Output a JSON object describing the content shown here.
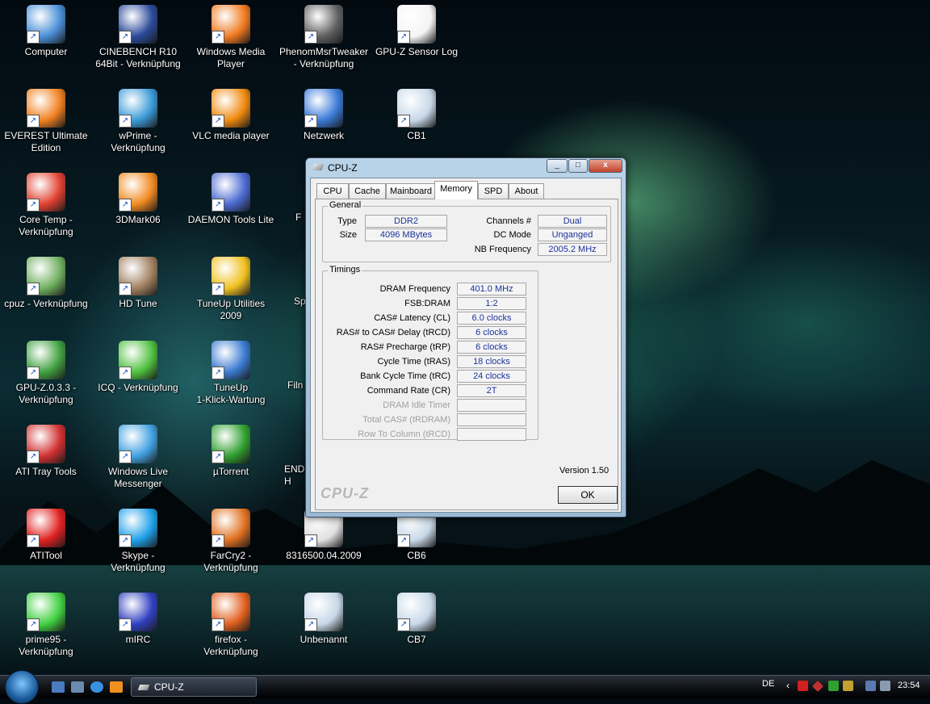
{
  "desktop": {
    "icons": [
      {
        "label": "Computer",
        "icon": "computer-icon",
        "color": "#4a8fd8"
      },
      {
        "label": "CINEBENCH R10\n64Bit - Verknüpfung",
        "icon": "cinebench-icon",
        "color": "#2a4a9a"
      },
      {
        "label": "Windows Media\nPlayer",
        "icon": "media-player-icon",
        "color": "#f07a20"
      },
      {
        "label": "PhenomMsrTweaker\n- Verknüpfung",
        "icon": "chip-icon",
        "color": "#606060"
      },
      {
        "label": "GPU-Z Sensor Log",
        "icon": "text-file-icon",
        "color": "#f4f4f4"
      },
      {
        "label": "EVEREST Ultimate\nEdition",
        "icon": "everest-icon",
        "color": "#f08020"
      },
      {
        "label": "wPrime -\nVerknüpfung",
        "icon": "wprime-icon",
        "color": "#3a9ad8"
      },
      {
        "label": "VLC media player",
        "icon": "vlc-icon",
        "color": "#f08a10"
      },
      {
        "label": "Netzwerk",
        "icon": "network-icon",
        "color": "#3a7ad8"
      },
      {
        "label": "CB1",
        "icon": "screenshot-file-icon",
        "color": "#c8d8e8"
      },
      {
        "label": "Core Temp -\nVerknüpfung",
        "icon": "thermometer-icon",
        "color": "#e04030"
      },
      {
        "label": "3DMark06",
        "icon": "3dmark-icon",
        "color": "#f08a20"
      },
      {
        "label": "DAEMON Tools Lite",
        "icon": "daemon-tools-icon",
        "color": "#4a6ad0"
      },
      {
        "label": "cpuz - Verknüpfung",
        "icon": "cpuz-icon",
        "color": "#70b060"
      },
      {
        "label": "HD Tune",
        "icon": "hd-tune-icon",
        "color": "#a08060"
      },
      {
        "label": "TuneUp Utilities 2009",
        "icon": "tuneup-icon",
        "color": "#f0c020"
      },
      {
        "label": "GPU-Z.0.3.3 -\nVerknüpfung",
        "icon": "graphics-card-icon",
        "color": "#40a040"
      },
      {
        "label": "ICQ - Verknüpfung",
        "icon": "icq-flower-icon",
        "color": "#50c040"
      },
      {
        "label": "TuneUp\n1-Klick-Wartung",
        "icon": "tuneup-wartung-icon",
        "color": "#3a7ad0"
      },
      {
        "label": "ATI Tray Tools",
        "icon": "ati-tray-icon",
        "color": "#d03030"
      },
      {
        "label": "Windows Live\nMessenger",
        "icon": "messenger-icon",
        "color": "#40a0e0"
      },
      {
        "label": "µTorrent",
        "icon": "utorrent-icon",
        "color": "#30a030"
      },
      {
        "label": "ATITool",
        "icon": "atitool-icon",
        "color": "#e02020"
      },
      {
        "label": "Skype - Verknüpfung",
        "icon": "skype-icon",
        "color": "#20a0e8"
      },
      {
        "label": "FarCry2 -\nVerknüpfung",
        "icon": "farcry-icon",
        "color": "#e07020"
      },
      {
        "label": "8316500.04.2009",
        "icon": "pdf-file-icon",
        "color": "#e0e0e0"
      },
      {
        "label": "CB6",
        "icon": "screenshot-file-icon",
        "color": "#c8d8e8"
      },
      {
        "label": "prime95 -\nVerknüpfung",
        "icon": "prime95-icon",
        "color": "#40d040"
      },
      {
        "label": "mIRC",
        "icon": "mirc-icon",
        "color": "#3040c0"
      },
      {
        "label": "firefox -\nVerknüpfung",
        "icon": "firefox-icon",
        "color": "#e06020"
      },
      {
        "label": "Unbenannt",
        "icon": "screenshot-file-icon",
        "color": "#c8d8e8"
      },
      {
        "label": "CB7",
        "icon": "screenshot-file-icon",
        "color": "#c8d8e8"
      }
    ],
    "partial_labels": [
      "F",
      "Sp",
      "Filn",
      "END\nH"
    ]
  },
  "window": {
    "title": "CPU-Z",
    "min": "_",
    "max": "□",
    "close": "x",
    "tabs": [
      "CPU",
      "Cache",
      "Mainboard",
      "Memory",
      "SPD",
      "About"
    ],
    "active_tab": "Memory",
    "general": {
      "label": "General",
      "type_label": "Type",
      "type_value": "DDR2",
      "size_label": "Size",
      "size_value": "4096 MBytes",
      "channels_label": "Channels #",
      "channels_value": "Dual",
      "dcmode_label": "DC Mode",
      "dcmode_value": "Unganged",
      "nbfreq_label": "NB Frequency",
      "nbfreq_value": "2005.2 MHz"
    },
    "timings": {
      "label": "Timings",
      "rows": [
        {
          "label": "DRAM Frequency",
          "value": "401.0 MHz"
        },
        {
          "label": "FSB:DRAM",
          "value": "1:2"
        },
        {
          "label": "CAS# Latency (CL)",
          "value": "6.0 clocks"
        },
        {
          "label": "RAS# to CAS# Delay (tRCD)",
          "value": "6 clocks"
        },
        {
          "label": "RAS# Precharge (tRP)",
          "value": "6 clocks"
        },
        {
          "label": "Cycle Time (tRAS)",
          "value": "18 clocks"
        },
        {
          "label": "Bank Cycle Time (tRC)",
          "value": "24 clocks"
        },
        {
          "label": "Command Rate (CR)",
          "value": "2T"
        },
        {
          "label": "DRAM Idle Timer",
          "value": ""
        },
        {
          "label": "Total CAS# (tRDRAM)",
          "value": ""
        },
        {
          "label": "Row To Column (tRCD)",
          "value": ""
        }
      ]
    },
    "version": "Version 1.50",
    "brand": "CPU-Z",
    "ok": "OK"
  },
  "taskbar": {
    "task": "CPU-Z",
    "lang": "DE",
    "clock": "23:54"
  }
}
